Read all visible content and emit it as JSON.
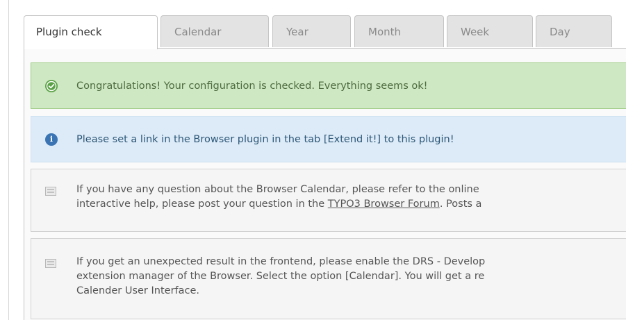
{
  "tabs": [
    {
      "label": "Plugin check",
      "active": true
    },
    {
      "label": "Calendar",
      "active": false
    },
    {
      "label": "Year",
      "active": false
    },
    {
      "label": "Month",
      "active": false
    },
    {
      "label": "Week",
      "active": false
    },
    {
      "label": "Day",
      "active": false
    }
  ],
  "messages": {
    "success": {
      "icon": "check-circle-icon",
      "text": "Congratulations! Your configuration is checked. Everything seems ok!",
      "color": "#cde8c2"
    },
    "info": {
      "icon": "info-circle-icon",
      "text": "Please set a link in the Browser plugin in the tab [Extend it!] to this plugin!",
      "color": "#dcebf7"
    },
    "note1": {
      "icon": "note-icon",
      "line1": "If you have any question about the Browser Calendar, please refer to the online",
      "line2_before": "interactive help, please post your question in the ",
      "link": "TYPO3 Browser Forum",
      "line2_after": ". Posts a"
    },
    "note2": {
      "icon": "note-icon",
      "line1": "If you get an unexpected result in the frontend, please enable the DRS - Develop",
      "line2": "extension manager of the Browser. Select the option [Calendar]. You will get a re",
      "line3": "Calender User Interface."
    }
  }
}
